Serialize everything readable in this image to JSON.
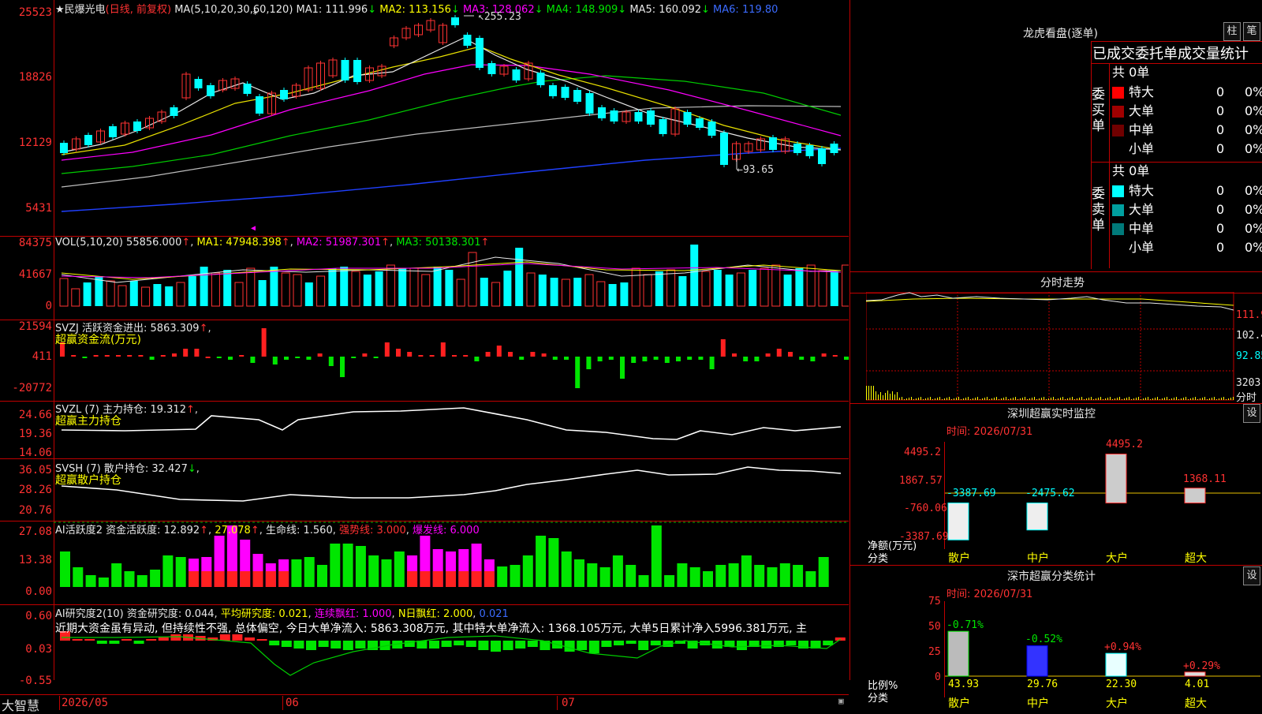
{
  "stock_title": "★民爆光电",
  "period_label": "(日线, 前复权)",
  "ma_header": {
    "name": "MA(5,10,20,30,60,120)",
    "items": [
      {
        "label": "MA1: 111.996",
        "arrow": "↓",
        "color": "#e8e8e8"
      },
      {
        "label": "MA2: 113.156",
        "arrow": "↓",
        "color": "#ffff00"
      },
      {
        "label": "MA3: 128.062",
        "arrow": "↓",
        "color": "#ff00ff"
      },
      {
        "label": "MA4: 148.909",
        "arrow": "↓",
        "color": "#00e600"
      },
      {
        "label": "MA5: 160.092",
        "arrow": "↓",
        "color": "#e8e8e8"
      },
      {
        "label": "MA6: 119.80",
        "arrow": "",
        "color": "#3b6bff"
      }
    ]
  },
  "price_axis": [
    "25523",
    "18826",
    "12129",
    "5431"
  ],
  "price_high_label": "255.23",
  "price_low_label": "←93.65",
  "vol_header": {
    "name": "VOL(5,10,20)",
    "value": "55856.000",
    "ma1": "MA1: 47948.398",
    "ma2": "MA2: 51987.301",
    "ma3": "MA3: 50138.301",
    "arrow": "↑"
  },
  "vol_axis": [
    "84375",
    "41667",
    "0"
  ],
  "svzj": {
    "header": "SVZJ  活跃资金进出: 5863.309",
    "arrow": "↑",
    "subtitle": "超赢资金流(万元)",
    "axis": [
      "21594",
      "411",
      "-20772"
    ]
  },
  "svzl": {
    "header": "SVZL (7) 主力持仓: 19.312",
    "arrow": "↑",
    "subtitle": "超赢主力持仓",
    "axis": [
      "24.66",
      "19.36",
      "14.06"
    ]
  },
  "svsh": {
    "header": "SVSH (7) 散户持仓: 32.427",
    "arrow": "↓",
    "subtitle": "超赢散户持仓",
    "axis": [
      "36.05",
      "28.26",
      "20.76"
    ]
  },
  "ai_active": {
    "header": "AI活跃度2 资金活跃度: 12.892",
    "arrow": "↑",
    "v2": "27.078",
    "life": "生命线: 1.560",
    "strong": "强势线: 3.000",
    "burst": "爆发线: 6.000",
    "axis": [
      "27.08",
      "13.38",
      "0.00"
    ]
  },
  "ai_research": {
    "header": "AI研究度2(10) 资金研究度: 0.044",
    "avg": "平均研究度: 0.021",
    "cont": "连续飘红: 1.000",
    "nday": "N日飘红: 2.000",
    "last": "0.021",
    "comment": "近期大资金虽有异动, 但持续性不强, 总体偏空, 今日大单净流入: 5863.308万元, 其中特大单净流入: 1368.105万元, 大单5日累计净入5996.381万元, 主",
    "axis": [
      "0.60",
      "0.03",
      "-0.55"
    ]
  },
  "date_axis": [
    "2026/05",
    "06",
    "07"
  ],
  "brand": "大智慧",
  "right": {
    "dragon_title": "龙虎看盘(逐单)",
    "btn_zhu": "柱",
    "btn_bi": "笔",
    "stats_title": "已成交委托单成交量统计",
    "buy_side": "委买单",
    "sell_side": "委卖单",
    "buy_total": "共 0单",
    "sell_total": "共 0单",
    "buy_rows": [
      {
        "label": "特大",
        "count": "0",
        "pct": "0%",
        "color": "#ff0000"
      },
      {
        "label": "大单",
        "count": "0",
        "pct": "0%",
        "color": "#a00000"
      },
      {
        "label": "中单",
        "count": "0",
        "pct": "0%",
        "color": "#700000"
      },
      {
        "label": "小单",
        "count": "0",
        "pct": "0%",
        "color": ""
      }
    ],
    "sell_rows": [
      {
        "label": "特大",
        "count": "0",
        "pct": "0%",
        "color": "#00ffff"
      },
      {
        "label": "大单",
        "count": "0",
        "pct": "0%",
        "color": "#00a0a0"
      },
      {
        "label": "中单",
        "count": "0",
        "pct": "0%",
        "color": "#007a7a"
      },
      {
        "label": "小单",
        "count": "0",
        "pct": "0%",
        "color": ""
      }
    ],
    "intraday_title": "分时走势",
    "intraday_axis": [
      "111.9",
      "102.4",
      "92.85",
      "3203",
      "分时"
    ],
    "sz_monitor": {
      "title": "深圳超赢实时监控",
      "btn": "设",
      "time": "时间: 2026/07/31",
      "axis": [
        "4495.2",
        "1867.57",
        "-760.06",
        "-3387.69"
      ],
      "ylabel": "净额(万元)",
      "xlabel": "分类",
      "categories": [
        "散户",
        "中户",
        "大户",
        "超大"
      ],
      "values": [
        "-3387.69",
        "-2475.62",
        "4495.2",
        "1368.11"
      ]
    },
    "sz_class": {
      "title": "深市超赢分类统计",
      "btn": "设",
      "time": "时间: 2026/07/31",
      "axis": [
        "75",
        "50",
        "25",
        "0"
      ],
      "ylabel": "比例%",
      "xlabel": "分类",
      "categories": [
        "散户",
        "中户",
        "大户",
        "超大"
      ],
      "values": [
        "43.93",
        "29.76",
        "22.30",
        "4.01"
      ],
      "changes": [
        "-0.71%",
        "-0.52%",
        "+0.94%",
        "+0.29%"
      ]
    }
  },
  "chart_data": [
    {
      "type": "bar",
      "title": "深圳超赢实时监控",
      "ylabel": "净额(万元)",
      "categories": [
        "散户",
        "中户",
        "大户",
        "超大"
      ],
      "values": [
        -3387.69,
        -2475.62,
        4495.2,
        1368.11
      ],
      "ylim": [
        -3387.69,
        4495.2
      ]
    },
    {
      "type": "bar",
      "title": "深市超赢分类统计",
      "ylabel": "比例%",
      "categories": [
        "散户",
        "中户",
        "大户",
        "超大"
      ],
      "values": [
        43.93,
        29.76,
        22.3,
        4.01
      ],
      "ylim": [
        0,
        75
      ]
    }
  ]
}
